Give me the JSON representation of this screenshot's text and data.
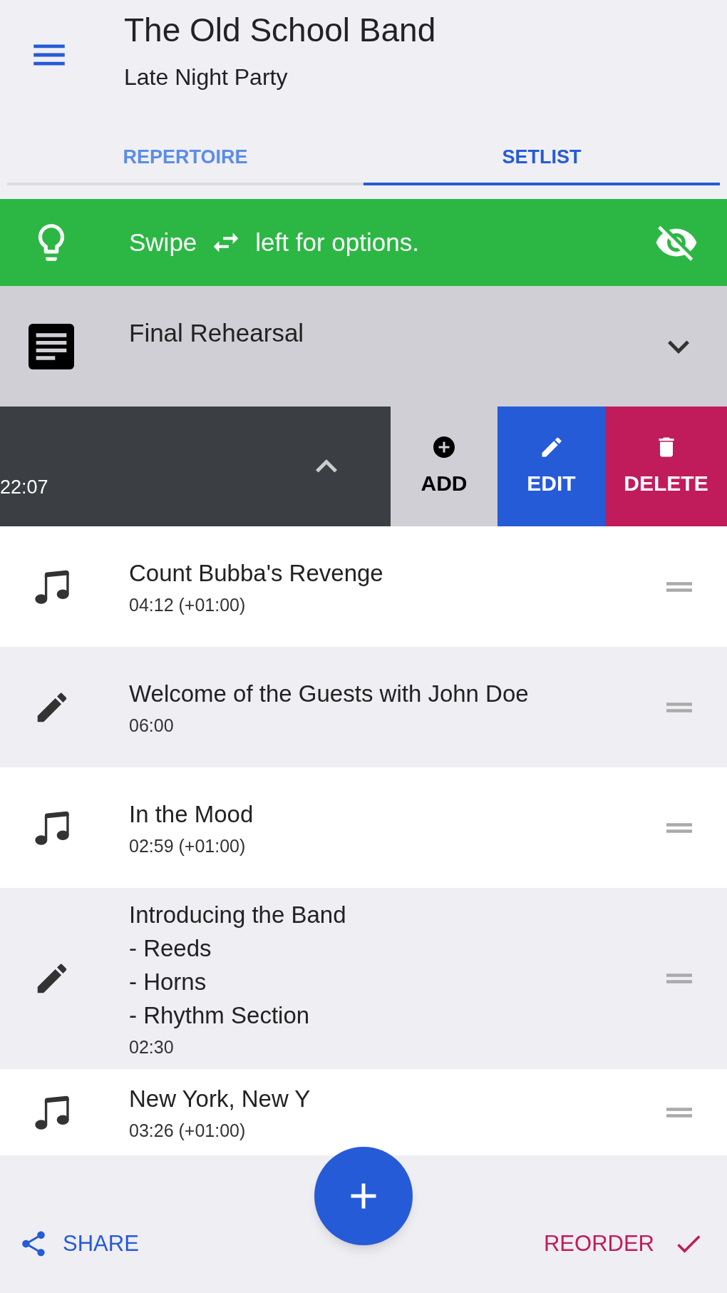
{
  "header": {
    "title": "The Old School Band",
    "subtitle": "Late Night Party"
  },
  "tabs": [
    {
      "label": "REPERTOIRE",
      "selected": false
    },
    {
      "label": "SETLIST",
      "selected": true
    }
  ],
  "tip": {
    "before": "Swipe",
    "after": "left for options."
  },
  "section": {
    "title": "Final Rehearsal",
    "expanded": false
  },
  "swiped_row": {
    "duration": "22:07",
    "expanded": true,
    "actions": [
      {
        "kind": "add",
        "label": "ADD"
      },
      {
        "kind": "edit",
        "label": "EDIT"
      },
      {
        "kind": "delete",
        "label": "DELETE"
      }
    ]
  },
  "items": [
    {
      "kind": "song",
      "title": "Count Bubba's Revenge",
      "duration": "04:12 (+01:00)"
    },
    {
      "kind": "note",
      "title": "Welcome of the Guests with John Doe",
      "duration": "06:00"
    },
    {
      "kind": "song",
      "title": "In the Mood",
      "duration": "02:59 (+01:00)"
    },
    {
      "kind": "note",
      "title": "Introducing the Band\n- Reeds\n- Horns\n- Rhythm Section",
      "duration": "02:30"
    },
    {
      "kind": "song",
      "title": "New York, New Y",
      "duration": "03:26 (+01:00)"
    }
  ],
  "bottom_bar": {
    "share": "SHARE",
    "reorder": "REORDER"
  }
}
